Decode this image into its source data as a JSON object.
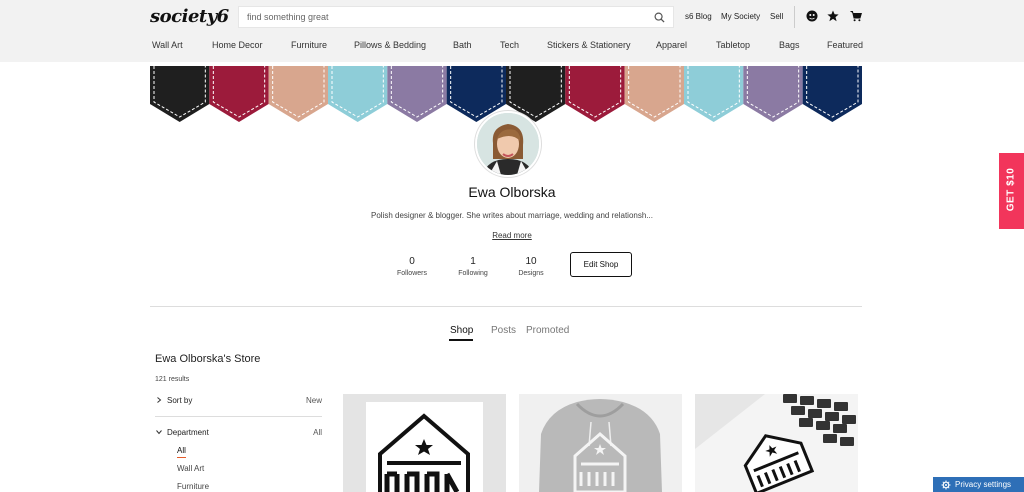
{
  "header": {
    "logo": "society6",
    "search_placeholder": "find something great",
    "links": {
      "blog": "s6 Blog",
      "my_society": "My Society",
      "sell": "Sell"
    }
  },
  "nav": [
    "Wall Art",
    "Home Decor",
    "Furniture",
    "Pillows & Bedding",
    "Bath",
    "Tech",
    "Stickers & Stationery",
    "Apparel",
    "Tabletop",
    "Bags",
    "Featured"
  ],
  "banner_colors": [
    "#1f1f1f",
    "#9c1b3b",
    "#d8a68e",
    "#8ecdd8",
    "#8b7aa3",
    "#0d2a5c"
  ],
  "profile": {
    "name": "Ewa Olborska",
    "bio": "Polish designer & blogger. She writes about marriage, wedding and relationsh...",
    "read_more": "Read more",
    "stats": [
      {
        "value": "0",
        "label": "Followers"
      },
      {
        "value": "1",
        "label": "Following"
      },
      {
        "value": "10",
        "label": "Designs"
      }
    ],
    "edit_button": "Edit Shop"
  },
  "tabs": [
    "Shop",
    "Posts",
    "Promoted"
  ],
  "store": {
    "title": "Ewa Olborska's Store",
    "results": "121 results",
    "sort": {
      "label": "Sort by",
      "value": "New"
    },
    "department": {
      "label": "Department",
      "value": "All"
    },
    "department_items": [
      "All",
      "Wall Art",
      "Furniture"
    ]
  },
  "gift_tab": "GET $10",
  "privacy": "Privacy settings"
}
